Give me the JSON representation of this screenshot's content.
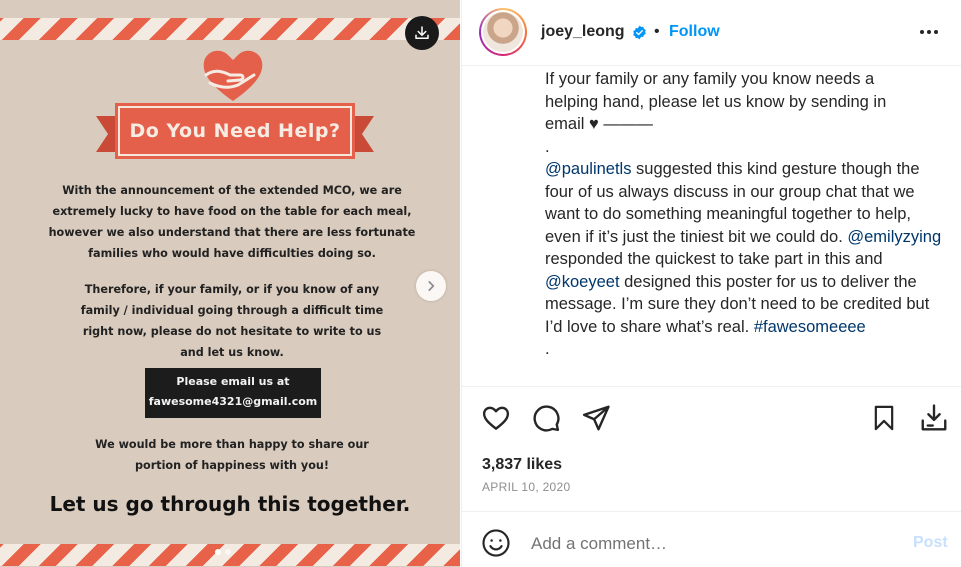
{
  "poster": {
    "title": "Do You Need Help?",
    "paragraph1": [
      "With the announcement of the extended MCO, we are",
      "extremely lucky to have food on the table for each meal,",
      "however we also understand that there are less fortunate",
      "families who would have difficulties doing so."
    ],
    "paragraph2": [
      "Therefore, if your family, or if you know of any",
      "family / individual going through a difficult time",
      "right now, please do not hesitate to write to us",
      "and let us know."
    ],
    "email_box": [
      "Please email us at",
      "fawesome4321@gmail.com"
    ],
    "paragraph3": [
      "We would be more than happy to share our",
      "portion of happiness with you!"
    ],
    "tagline": "Let us go through this together.",
    "carousel": {
      "total": 2,
      "active": 1
    },
    "colors": {
      "accent": "#e5604a",
      "background": "#d9cbbd"
    }
  },
  "header": {
    "username": "joey_leong",
    "separator": "•",
    "follow_label": "Follow",
    "verified_color": "#0095f6"
  },
  "caption": {
    "line1": "If your family or any family you know needs a",
    "line2": "helping hand, please let us know by sending in",
    "line3": "email ♥ ———",
    "dot1": ".",
    "mention1": "@paulinetls",
    "text1": " suggested this kind gesture though the four of us always discuss in our group chat that we want to do something meaningful together to help, even if it’s just the tiniest bit we could do. ",
    "mention2": "@emilyzying",
    "text2": " responded the quickest to take part in this and ",
    "mention3": "@koeyeet",
    "text3": " designed this poster for us to deliver the message. I’m sure they don’t need to be credited but I’d love to share what’s real. ",
    "hashtag": "#fawesomeeee",
    "dot2": "."
  },
  "engagement": {
    "likes": "3,837 likes",
    "date": "APRIL 10, 2020"
  },
  "comment": {
    "placeholder": "Add a comment…",
    "post_label": "Post"
  }
}
